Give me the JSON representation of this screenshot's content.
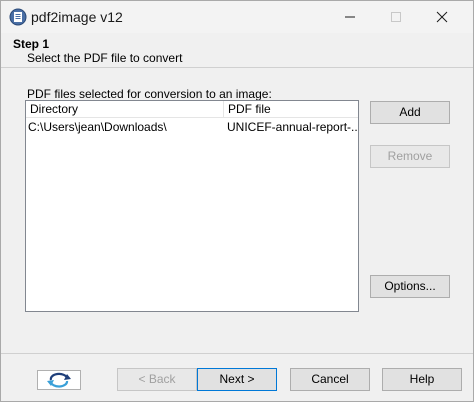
{
  "window": {
    "title": "pdf2image v12"
  },
  "header": {
    "step_title": "Step 1",
    "step_description": "Select the PDF file to convert"
  },
  "file_list": {
    "caption": "PDF files selected for conversion to an image:",
    "columns": [
      "Directory",
      "PDF file"
    ],
    "rows": [
      {
        "directory": "C:\\Users\\jean\\Downloads\\",
        "pdf_file": "UNICEF-annual-report-..."
      }
    ]
  },
  "side_buttons": {
    "add": "Add",
    "remove": "Remove",
    "options": "Options..."
  },
  "footer_buttons": {
    "back": "< Back",
    "next": "Next >",
    "cancel": "Cancel",
    "help": "Help"
  },
  "icons": {
    "app": "pdf2image-app-icon",
    "logo": "refresh-arrows-logo"
  },
  "colors": {
    "accent": "#0078d7",
    "window_bg": "#f0f0f0",
    "disabled_text": "#a0a0a0"
  }
}
